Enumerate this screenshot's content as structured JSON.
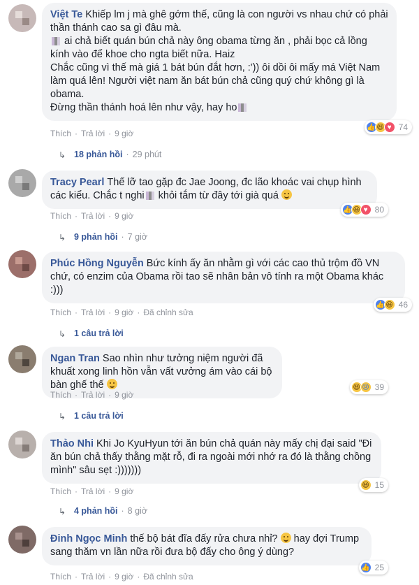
{
  "comments": [
    {
      "author": "Việt Te",
      "text_1": "Khiếp lm j mà ghê gớm thế, cũng là con người vs nhau chứ có phải thần thánh cao sa gì đâu mà.",
      "text_2": " ai chả biết quán bún chả này ông obama từng ăn , phải bọc cả lồng kính vào để khoe cho ngta biết nữa. Haiz\nChắc cũng vì thế mà giá 1 bát bún đắt hơn, :')) ôi dồi ôi mấy má Việt Nam làm quá lên! Người việt nam ăn bát bún chả cũng quý chứ không gì là obama.\nĐừng thần thánh hoá lên như vậy, hay ho",
      "like": "Thích",
      "reply": "Trả lời",
      "time": "9 giờ",
      "reaction_count": "74",
      "replies_label": "18 phản hồi",
      "replies_time": "29 phút"
    },
    {
      "author": "Tracy Pearl",
      "text_1": "Thế lỡ tao gặp đc Jae Joong, đc lão khoác vai chụp hình các kiểu. Chắc t nghi",
      "text_2": " khỏi tắm từ đây tới già quá",
      "like": "Thích",
      "reply": "Trả lời",
      "time": "9 giờ",
      "reaction_count": "80",
      "replies_label": "9 phản hồi",
      "replies_time": "7 giờ"
    },
    {
      "author": "Phúc Hồng Nguyễn",
      "text_1": "Bức kính ấy ăn nhằm gì với các cao thủ trộm đồ VN chứ, có enzim của Obama rồi tao sẽ nhân bản vô tính ra một Obama khác :)))",
      "like": "Thích",
      "reply": "Trả lời",
      "time": "9 giờ",
      "edited": "Đã chỉnh sửa",
      "reaction_count": "46",
      "replies_label": "1 câu trả lời"
    },
    {
      "author": "Ngan Tran",
      "text_1": "Sao nhìn như tưởng niệm người đã khuất xong linh hồn vẫn vất vưởng ám vào cái bộ bàn ghế thế",
      "like": "Thích",
      "reply": "Trả lời",
      "time": "9 giờ",
      "reaction_count": "39",
      "replies_label": "1 câu trả lời"
    },
    {
      "author": "Thảo Nhi",
      "text_1": "Khi Jo KyuHyun tới ăn bún chả quán này mấy chị đại said \"Đi ăn bún chả thấy thằng mặt rỗ, đi ra ngoài mới nhớ ra đó là thằng chồng mình\" sâu sẹt :)))))))",
      "like": "Thích",
      "reply": "Trả lời",
      "time": "9 giờ",
      "reaction_count": "15",
      "replies_label": "4 phản hồi",
      "replies_time": "8 giờ"
    },
    {
      "author": "Đinh Ngọc Minh",
      "text_1": "thế bộ bát đĩa đấy rửa chưa nhỉ?",
      "text_2": " hay đợi Trump sang thăm vn lần nữa rồi đưa bộ đấy cho ông ý dùng?",
      "like": "Thích",
      "reply": "Trả lời",
      "time": "9 giờ",
      "edited": "Đã chỉnh sửa",
      "reaction_count": "25"
    }
  ],
  "icons": [
    "like-reaction-icon",
    "haha-reaction-icon",
    "love-reaction-icon",
    "sad-reaction-icon",
    "reply-arrow-icon"
  ],
  "colors": {
    "name": "#385898",
    "bubble": "#f2f3f5",
    "meta": "#90949c",
    "like": "#4f82ed"
  }
}
